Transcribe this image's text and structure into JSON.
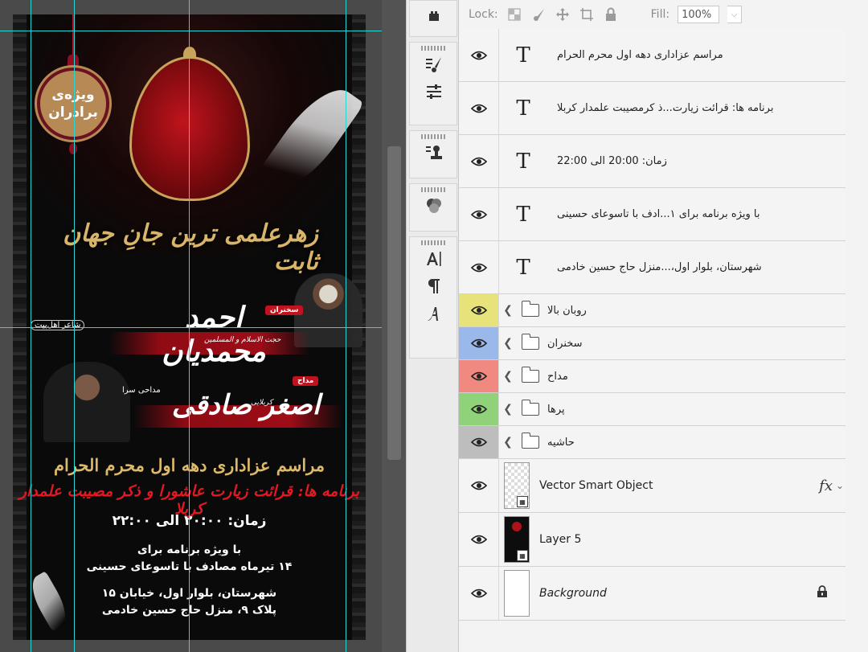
{
  "poster": {
    "badge_line1": "ویژه‌ی",
    "badge_line2": "برادران",
    "calligraphy": "زهرعلمی ترین جانِ جهان ثابت",
    "speaker1_tag": "سخنران",
    "speaker1_name": "احمد محمدیان",
    "speaker1_prefix": "حجت الاسلام و المسلمین",
    "speaker1_title": "شاعر اهل‌بیت",
    "speaker2_tag": "مداح",
    "speaker2_name": "اصغر صادقی",
    "speaker2_prefix": "کربلایی",
    "speaker2_title": "مداحی سرا",
    "ceremony": "مراسم عزاداری دهه اول محرم الحرام",
    "program": "برنامه ها: قرائت زیارت عاشورا و ذکر مصیبت علمدار کربلا",
    "time": "زمان: ۲۰:۰۰ الی ۲۲:۰۰",
    "special_line1": "با ویژه برنامه برای",
    "special_line2": "۱۴ تیرماه مصادف با تاسوعای حسینی",
    "address_line1": "شهرستان، بلوار اول، خیابان ۱۵",
    "address_line2": "پلاک ۹، منزل حاج حسین خادمی"
  },
  "lock_bar": {
    "lock_label": "Lock:",
    "fill_label": "Fill:",
    "fill_value": "100%"
  },
  "layers": {
    "text_layers": [
      {
        "name": "مراسم عزاداری دهه اول محرم الحرام"
      },
      {
        "name": "برنامه ها: قرائت زیارت...ذ کرمصیبت علمدار کربلا"
      },
      {
        "name": "زمان: 20:00 الی 22:00"
      },
      {
        "name": "با ویژه برنامه برای ۱...ادف با تاسوعای حسینی"
      },
      {
        "name": "شهرستان، بلوار اول،...منزل حاج حسین خادمی"
      }
    ],
    "groups": [
      {
        "name": "روبان بالا",
        "color": "#e8e27a"
      },
      {
        "name": "سخنران",
        "color": "#9ab8ea"
      },
      {
        "name": "مداح",
        "color": "#f08a80"
      },
      {
        "name": "پرها",
        "color": "#8fd27a"
      },
      {
        "name": "حاشیه",
        "color": "#bdbdbd"
      }
    ],
    "vso_name": "Vector Smart Object",
    "fx_label": "fx",
    "layer5_name": "Layer 5",
    "background_name": "Background"
  }
}
